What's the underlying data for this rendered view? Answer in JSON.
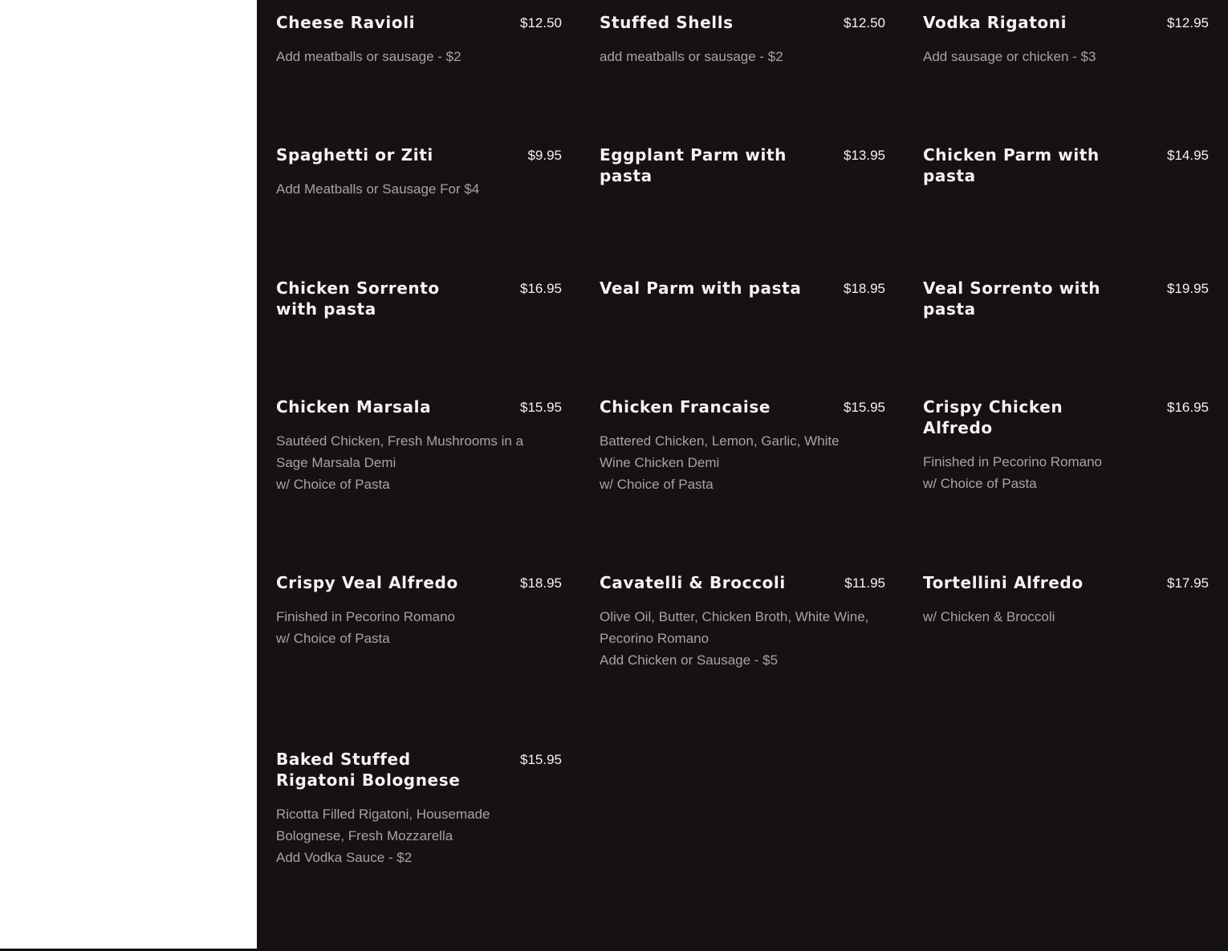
{
  "menu": {
    "items": [
      {
        "name": "Cheese Ravioli",
        "price": "$12.50",
        "desc": [
          "Add meatballs or sausage - $2"
        ]
      },
      {
        "name": "Stuffed Shells",
        "price": "$12.50",
        "desc": [
          "add meatballs or sausage - $2"
        ]
      },
      {
        "name": "Vodka Rigatoni",
        "price": "$12.95",
        "desc": [
          "Add sausage or chicken - $3"
        ]
      },
      {
        "name": "Spaghetti or Ziti",
        "price": "$9.95",
        "desc": [
          "Add Meatballs or Sausage For $4"
        ]
      },
      {
        "name": "Eggplant Parm with pasta",
        "price": "$13.95",
        "desc": []
      },
      {
        "name": "Chicken Parm with pasta",
        "price": "$14.95",
        "desc": []
      },
      {
        "name": "Chicken Sorrento with pasta",
        "price": "$16.95",
        "desc": []
      },
      {
        "name": "Veal Parm with pasta",
        "price": "$18.95",
        "desc": []
      },
      {
        "name": "Veal Sorrento with pasta",
        "price": "$19.95",
        "desc": []
      },
      {
        "name": "Chicken Marsala",
        "price": "$15.95",
        "desc": [
          "Sautéed Chicken, Fresh Mushrooms in a",
          "Sage Marsala Demi",
          "w/ Choice of Pasta"
        ]
      },
      {
        "name": "Chicken Francaise",
        "price": "$15.95",
        "desc": [
          "Battered Chicken, Lemon, Garlic, White",
          "Wine Chicken Demi",
          "w/ Choice of Pasta"
        ]
      },
      {
        "name": "Crispy Chicken Alfredo",
        "price": "$16.95",
        "desc": [
          "Finished in Pecorino Romano",
          "w/ Choice of Pasta"
        ]
      },
      {
        "name": "Crispy Veal Alfredo",
        "price": "$18.95",
        "desc": [
          "Finished in Pecorino Romano",
          "w/ Choice of Pasta"
        ]
      },
      {
        "name": "Cavatelli & Broccoli",
        "price": "$11.95",
        "desc": [
          "Olive Oil, Butter, Chicken Broth, White Wine,",
          "Pecorino Romano",
          "Add Chicken or Sausage - $5"
        ]
      },
      {
        "name": "Tortellini Alfredo",
        "price": "$17.95",
        "desc": [
          "w/ Chicken & Broccoli"
        ]
      },
      {
        "name": "Baked Stuffed Rigatoni Bolognese",
        "price": "$15.95",
        "desc": [
          "Ricotta Filled Rigatoni, Housemade",
          "Bolognese, Fresh Mozzarella",
          "Add Vodka Sauce - $2"
        ]
      }
    ]
  },
  "colors": {
    "background": "#161214",
    "name": "#f4f2f3",
    "price": "#f4f2f3",
    "description": "#a7a3a5"
  }
}
